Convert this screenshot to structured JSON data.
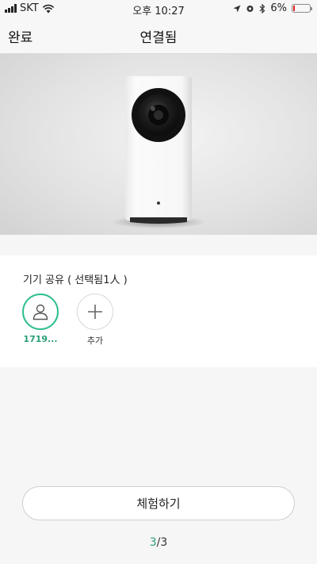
{
  "status_bar": {
    "carrier": "SKT",
    "time": "오후 10:27",
    "battery": "6%",
    "battery_level": 0.06,
    "icons": [
      "signal-icon",
      "wifi-icon",
      "location-arrow-icon",
      "alarm-icon",
      "bluetooth-icon",
      "battery-icon"
    ]
  },
  "nav": {
    "done_label": "완료",
    "title": "연결됨"
  },
  "share": {
    "title": "기기 공유 ( 선택됨1人 )",
    "members": [
      {
        "label": "1719...",
        "icon": "user-icon",
        "selected": true
      }
    ],
    "add": {
      "label": "추가",
      "icon": "plus-icon"
    }
  },
  "experience_button_label": "체험하기",
  "pager": {
    "current": "3",
    "separator": "/",
    "total": "3"
  },
  "colors": {
    "accent": "#2dbf8d",
    "accent_text": "#2a9e78",
    "battery_low": "#e02020"
  }
}
